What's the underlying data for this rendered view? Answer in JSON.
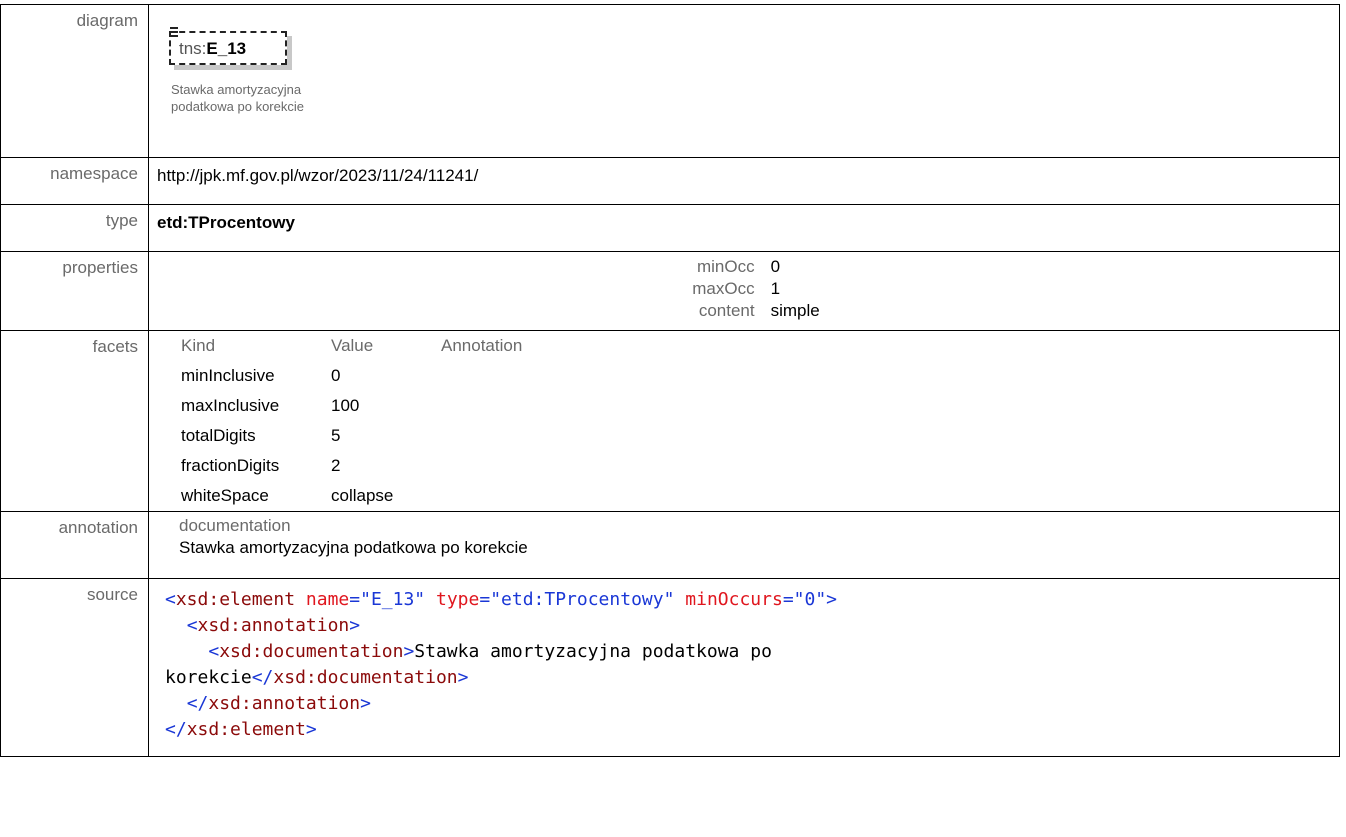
{
  "rows": {
    "diagram": {
      "label": "diagram",
      "prefix": "tns:",
      "name": "E_13",
      "caption_line1": "Stawka amortyzacyjna",
      "caption_line2": "podatkowa po korekcie"
    },
    "namespace": {
      "label": "namespace",
      "value": "http://jpk.mf.gov.pl/wzor/2023/11/24/11241/"
    },
    "type": {
      "label": "type",
      "value": "etd:TProcentowy"
    },
    "properties": {
      "label": "properties",
      "items": [
        {
          "key": "minOcc",
          "value": "0"
        },
        {
          "key": "maxOcc",
          "value": "1"
        },
        {
          "key": "content",
          "value": "simple"
        }
      ]
    },
    "facets": {
      "label": "facets",
      "headers": [
        "Kind",
        "Value",
        "Annotation"
      ],
      "items": [
        {
          "kind": "minInclusive",
          "value": "0"
        },
        {
          "kind": "maxInclusive",
          "value": "100"
        },
        {
          "kind": "totalDigits",
          "value": "5"
        },
        {
          "kind": "fractionDigits",
          "value": "2"
        },
        {
          "kind": "whiteSpace",
          "value": "collapse"
        }
      ]
    },
    "annotation": {
      "label": "annotation",
      "kind": "documentation",
      "text": "Stawka amortyzacyjna podatkowa po korekcie"
    },
    "source": {
      "label": "source",
      "lines": [
        "<xsd:element name=\"E_13\" type=\"etd:TProcentowy\" minOccurs=\"0\">",
        "  <xsd:annotation>",
        "    <xsd:documentation>Stawka amortyzacyjna podatkowa po",
        "korekcie</xsd:documentation>",
        "  </xsd:annotation>",
        "</xsd:element>"
      ]
    }
  },
  "colors": {
    "label_gray": "#6a6a6a",
    "xml_tag": "#8b0a0a",
    "xml_bracket": "#1a37d6",
    "xml_attr": "#e0161e"
  }
}
